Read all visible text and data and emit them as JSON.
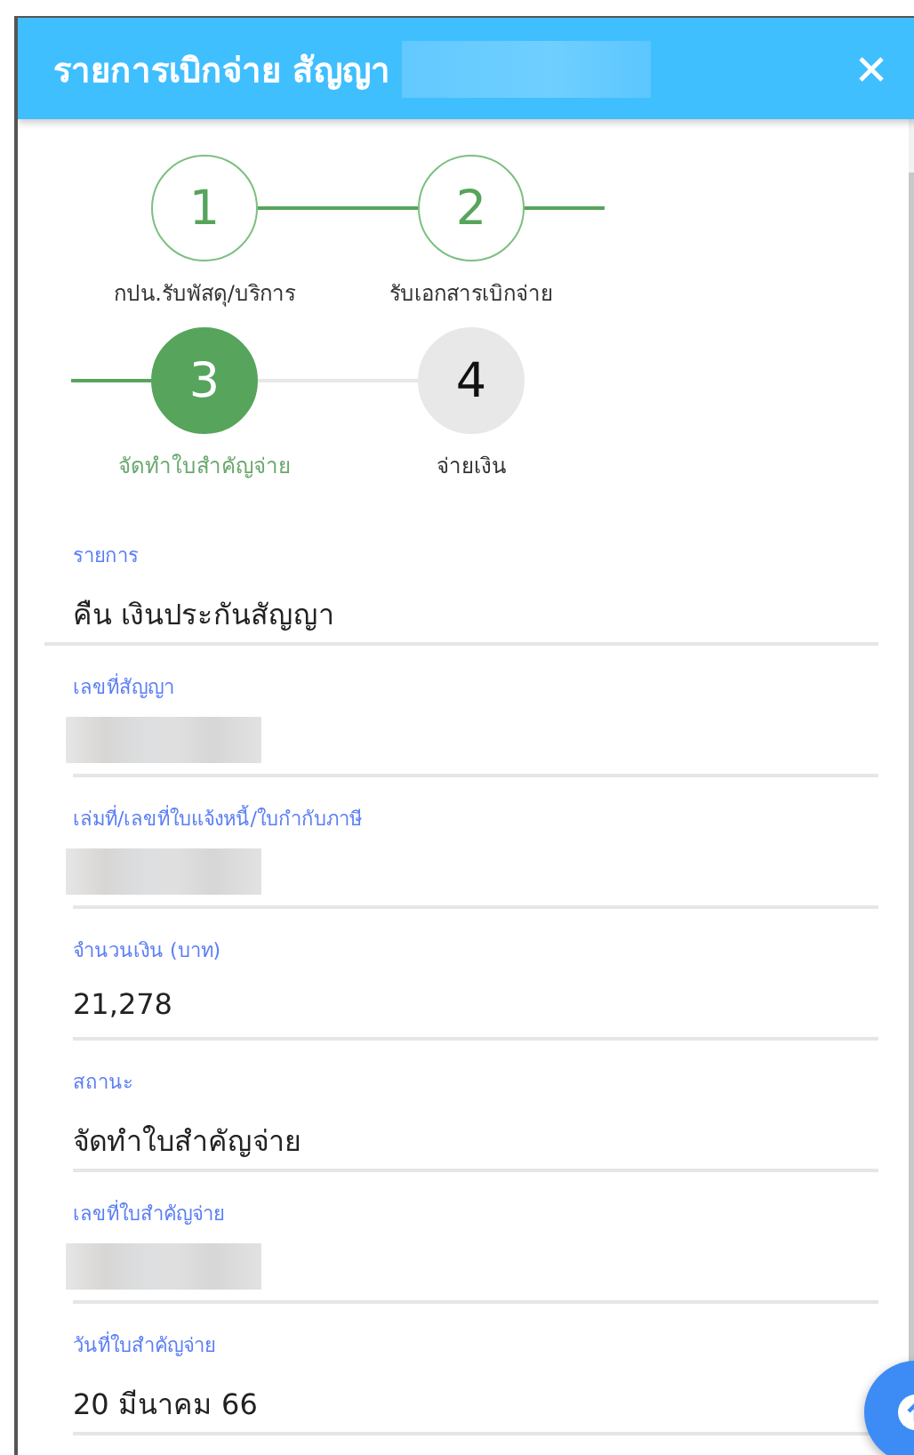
{
  "window": {
    "title": "รายการเบิกจ่าย สัญญา",
    "title_redacted": true
  },
  "steps": [
    {
      "number": "1",
      "label": "กปน.รับพัสดุ/บริการ",
      "completed": true,
      "selected": false
    },
    {
      "number": "2",
      "label": "รับเอกสารเบิกจ่าย",
      "completed": true,
      "selected": false
    },
    {
      "number": "3",
      "label": "จัดทำใบสำคัญจ่าย",
      "completed": false,
      "selected": true
    },
    {
      "number": "4",
      "label": "จ่ายเงิน",
      "completed": false,
      "selected": false
    }
  ],
  "fields": [
    {
      "label": "รายการ",
      "kind": "text",
      "value": "คืน เงินประกันสัญญา"
    },
    {
      "label": "เลขที่สัญญา",
      "kind": "redacted"
    },
    {
      "label": "เล่มที่/เลขที่ใบแจ้งหนี้/ใบกำกับภาษี",
      "kind": "redacted"
    },
    {
      "label": "จำนวนเงิน (บาท)",
      "kind": "text",
      "value": "21,278"
    },
    {
      "label": "สถานะ",
      "kind": "text",
      "value": "จัดทำใบสำคัญจ่าย"
    },
    {
      "label": "เลขที่ใบสำคัญจ่าย",
      "kind": "redacted"
    },
    {
      "label": "วันที่ใบสำคัญจ่าย",
      "kind": "text",
      "value": "20 มีนาคม 66"
    }
  ]
}
